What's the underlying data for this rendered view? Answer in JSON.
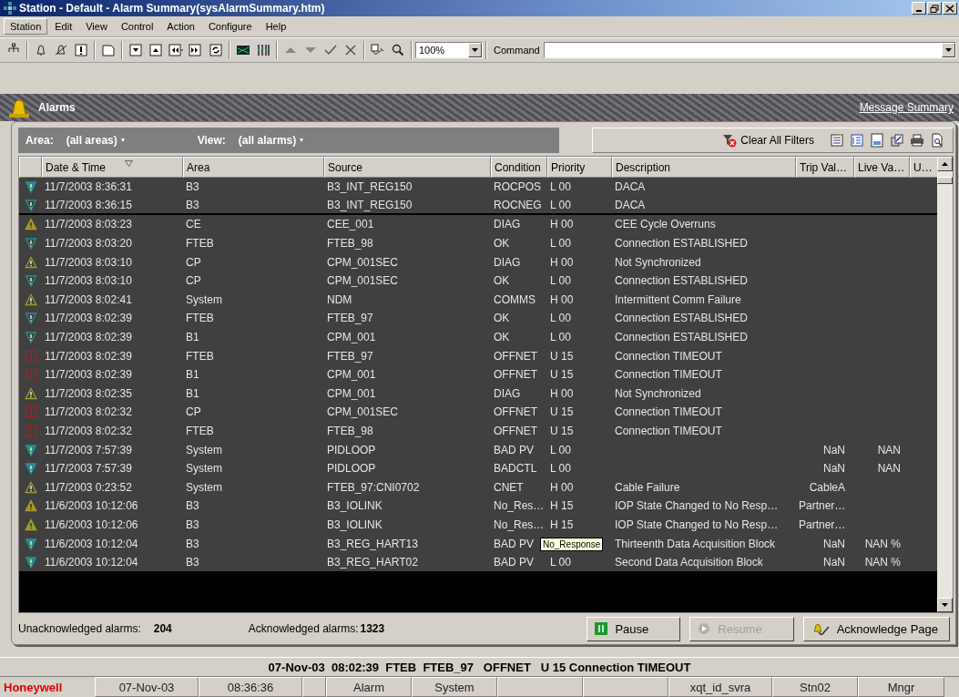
{
  "window": {
    "title": "Station - Default - Alarm Summary(sysAlarmSummary.htm)"
  },
  "menu": [
    {
      "label": "Station",
      "selected": true
    },
    {
      "label": "Edit",
      "selected": false
    },
    {
      "label": "View",
      "selected": false
    },
    {
      "label": "Control",
      "selected": false
    },
    {
      "label": "Action",
      "selected": false
    },
    {
      "label": "Configure",
      "selected": false
    },
    {
      "label": "Help",
      "selected": false
    }
  ],
  "toolbar": {
    "zoom": "100%",
    "command_label": "Command"
  },
  "header": {
    "title": "Alarms",
    "link": "Message Summary"
  },
  "filters": {
    "area_label": "Area:",
    "area": "(all areas)",
    "view_label": "View:",
    "view": "(all alarms)",
    "clear_button": "Clear All Filters"
  },
  "table": {
    "columns": [
      {
        "label": "Date & Time",
        "sorted": true
      },
      {
        "label": "Area",
        "sorted": false
      },
      {
        "label": "Source",
        "sorted": false
      },
      {
        "label": "Condition",
        "sorted": false
      },
      {
        "label": "Priority",
        "sorted": false
      },
      {
        "label": "Description",
        "sorted": false
      },
      {
        "label": "Trip Val…",
        "sorted": false
      },
      {
        "label": "Live Va…",
        "sorted": false
      },
      {
        "label": "U…",
        "sorted": false
      }
    ],
    "rows": [
      {
        "kind": "low",
        "solid": true,
        "separator_below": false,
        "date": "11/7/2003 8:36:31",
        "area": "B3",
        "source": "B3_INT_REG150",
        "condition": "ROCPOS",
        "priority": "L 00",
        "description": "DACA"
      },
      {
        "kind": "low",
        "solid": false,
        "separator_below": true,
        "date": "11/7/2003 8:36:15",
        "area": "B3",
        "source": "B3_INT_REG150",
        "condition": "ROCNEG",
        "priority": "L 00",
        "description": "DACA"
      },
      {
        "kind": "high",
        "solid": true,
        "separator_below": false,
        "date": "11/7/2003 8:03:23",
        "area": "CE",
        "source": "CEE_001",
        "condition": "DIAG",
        "priority": "H 00",
        "description": "CEE Cycle Overruns"
      },
      {
        "kind": "low",
        "solid": false,
        "separator_below": false,
        "date": "11/7/2003 8:03:20",
        "area": "FTEB",
        "source": "FTEB_98",
        "condition": "OK",
        "priority": "L 00",
        "description": "Connection ESTABLISHED"
      },
      {
        "kind": "high",
        "solid": false,
        "separator_below": false,
        "date": "11/7/2003 8:03:10",
        "area": "CP",
        "source": "CPM_001SEC",
        "condition": "DIAG",
        "priority": "H 00",
        "description": "Not Synchronized"
      },
      {
        "kind": "low",
        "solid": false,
        "separator_below": false,
        "date": "11/7/2003 8:03:10",
        "area": "CP",
        "source": "CPM_001SEC",
        "condition": "OK",
        "priority": "L 00",
        "description": "Connection ESTABLISHED"
      },
      {
        "kind": "high",
        "solid": false,
        "separator_below": false,
        "date": "11/7/2003 8:02:41",
        "area": "System",
        "source": "NDM",
        "condition": "COMMS",
        "priority": "H 00",
        "description": "Intermittent Comm Failure"
      },
      {
        "kind": "low",
        "solid": false,
        "separator_below": false,
        "date": "11/7/2003 8:02:39",
        "area": "FTEB",
        "source": "FTEB_97",
        "condition": "OK",
        "priority": "L 00",
        "description": "Connection ESTABLISHED"
      },
      {
        "kind": "low",
        "solid": false,
        "separator_below": false,
        "date": "11/7/2003 8:02:39",
        "area": "B1",
        "source": "CPM_001",
        "condition": "OK",
        "priority": "L 00",
        "description": "Connection ESTABLISHED"
      },
      {
        "kind": "urgent",
        "solid": false,
        "separator_below": false,
        "date": "11/7/2003 8:02:39",
        "area": "FTEB",
        "source": "FTEB_97",
        "condition": "OFFNET",
        "priority": "U 15",
        "description": "Connection TIMEOUT"
      },
      {
        "kind": "urgent",
        "solid": false,
        "separator_below": false,
        "date": "11/7/2003 8:02:39",
        "area": "B1",
        "source": "CPM_001",
        "condition": "OFFNET",
        "priority": "U 15",
        "description": "Connection TIMEOUT"
      },
      {
        "kind": "high",
        "solid": false,
        "separator_below": false,
        "date": "11/7/2003 8:02:35",
        "area": "B1",
        "source": "CPM_001",
        "condition": "DIAG",
        "priority": "H 00",
        "description": "Not Synchronized"
      },
      {
        "kind": "urgent",
        "solid": false,
        "separator_below": false,
        "date": "11/7/2003 8:02:32",
        "area": "CP",
        "source": "CPM_001SEC",
        "condition": "OFFNET",
        "priority": "U 15",
        "description": "Connection TIMEOUT"
      },
      {
        "kind": "urgent",
        "solid": false,
        "separator_below": false,
        "date": "11/7/2003 8:02:32",
        "area": "FTEB",
        "source": "FTEB_98",
        "condition": "OFFNET",
        "priority": "U 15",
        "description": "Connection TIMEOUT"
      },
      {
        "kind": "low",
        "solid": true,
        "separator_below": false,
        "date": "11/7/2003 7:57:39",
        "area": "System",
        "source": "PIDLOOP",
        "condition": "BAD PV",
        "priority": "L 00",
        "trip_value": "NaN",
        "live_value": "NAN"
      },
      {
        "kind": "low",
        "solid": true,
        "separator_below": false,
        "date": "11/7/2003 7:57:39",
        "area": "System",
        "source": "PIDLOOP",
        "condition": "BADCTL",
        "priority": "L 00",
        "trip_value": "NaN",
        "live_value": "NAN"
      },
      {
        "kind": "high",
        "solid": false,
        "separator_below": false,
        "date": "11/7/2003 0:23:52",
        "area": "System",
        "source": "FTEB_97:CNI0702",
        "condition": "CNET",
        "priority": "H 00",
        "description": "Cable Failure",
        "trip_value": "CableA"
      },
      {
        "kind": "high",
        "solid": true,
        "separator_below": false,
        "date": "11/6/2003 10:12:06",
        "area": "B3",
        "source": "B3_IOLINK",
        "condition": "No_Res…",
        "priority": "H 15",
        "description": "IOP State Changed to No Resp…",
        "trip_value": "Partner…"
      },
      {
        "kind": "high",
        "solid": true,
        "separator_below": false,
        "date": "11/6/2003 10:12:06",
        "area": "B3",
        "source": "B3_IOLINK",
        "condition": "No_Res…",
        "priority": "H 15",
        "description": "IOP State Changed to No Resp…",
        "trip_value": "Partner…"
      },
      {
        "kind": "low",
        "solid": true,
        "separator_below": false,
        "date": "11/6/2003 10:12:04",
        "area": "B3",
        "source": "B3_REG_HART13",
        "condition": "BAD PV",
        "description": "Thirteenth Data Acquisition Block",
        "trip_value": "NaN",
        "live_value": "NAN %"
      },
      {
        "kind": "low",
        "solid": true,
        "separator_below": false,
        "date": "11/6/2003 10:12:04",
        "area": "B3",
        "source": "B3_REG_HART02",
        "condition": "BAD PV",
        "priority": "L 00",
        "description": "Second Data Acquisition Block",
        "trip_value": "NaN",
        "live_value": "NAN %"
      }
    ],
    "tooltip": "No_Response"
  },
  "footer": {
    "unack_label": "Unacknowledged alarms:",
    "unack_count": "204",
    "ack_label": "Acknowledged alarms:",
    "ack_count": "1323",
    "buttons": [
      {
        "label": "Pause",
        "kind": "pause",
        "disabled": false
      },
      {
        "label": "Resume",
        "kind": "resume",
        "disabled": true
      },
      {
        "label": "Acknowledge Page",
        "kind": "acknowledge",
        "disabled": false
      }
    ]
  },
  "message_line": "07-Nov-03  08:02:39  FTEB  FTEB_97   OFFNET   U 15 Connection TIMEOUT",
  "status_bar": {
    "brand": "Honeywell",
    "cells": [
      "07-Nov-03",
      "08:36:36",
      null,
      "Alarm",
      "System",
      null,
      null,
      "xqt_id_svra",
      "Stn02",
      "Mngr"
    ]
  }
}
